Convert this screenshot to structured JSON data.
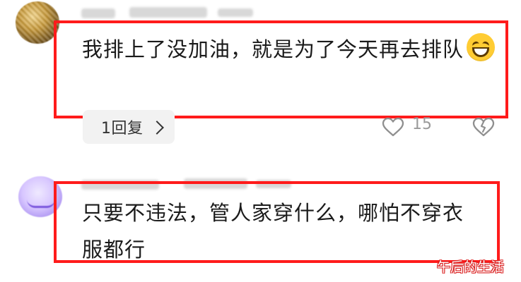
{
  "comments": [
    {
      "text": "我排上了没加油，就是为了今天再去排队",
      "emoji": "grinning-face-emoji",
      "reply_label": "1回复",
      "likes": "15"
    },
    {
      "text": "只要不违法，管人家穿什么，哪怕不穿衣服都行"
    }
  ],
  "watermark": "午后的生活",
  "colors": {
    "highlight": "#ff1b1b",
    "text": "#1a1a1a",
    "meta": "#9a9a9a",
    "pill_bg": "#f2f2f2"
  }
}
